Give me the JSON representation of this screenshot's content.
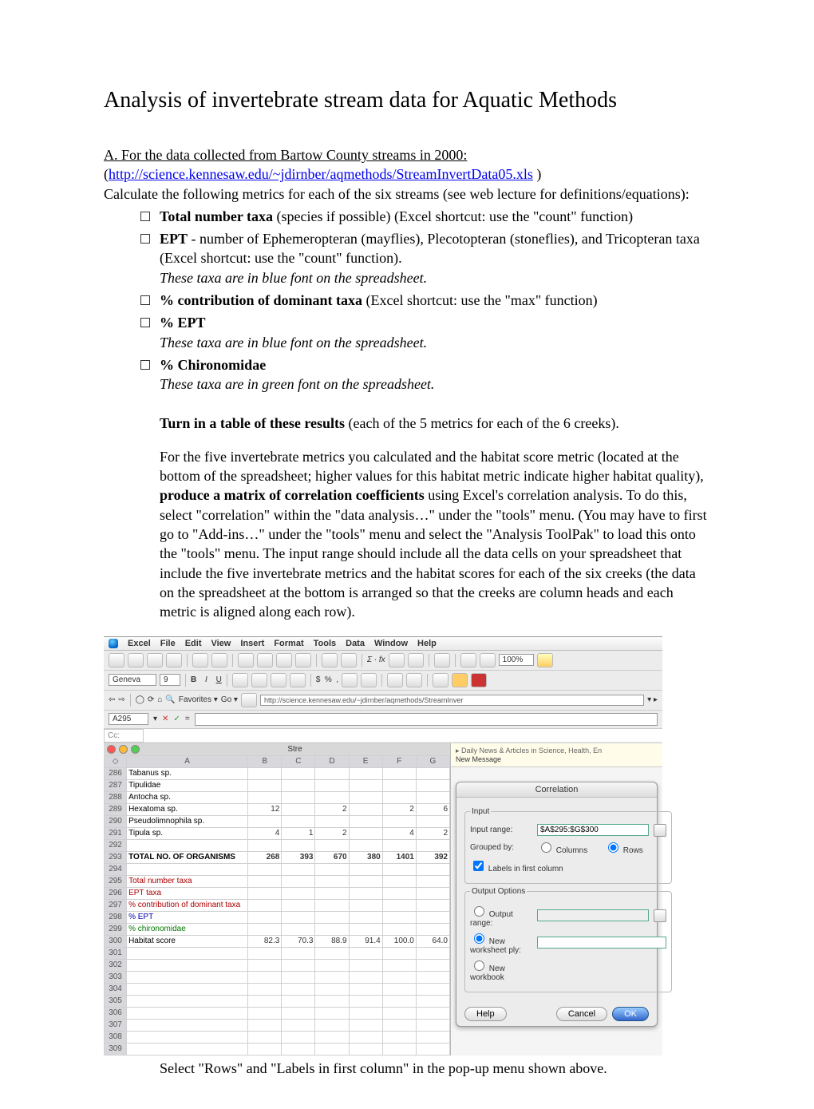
{
  "title": "Analysis of invertebrate stream data for Aquatic Methods",
  "sectionA_intro": "A. For the data collected from Bartow County streams in 2000:",
  "url_text": "http://science.kennesaw.edu/~jdirnber/aqmethods/StreamInvertData05.xls",
  "lead_in": "Calculate the following metrics for each of the six streams (see web lecture for definitions/equations):",
  "bullets": {
    "b1a": "Total number taxa",
    "b1b": " (species if possible)  (Excel shortcut: use the \"count\" function)",
    "b2a": "EPT",
    "b2b": " - number of Ephemeropteran (mayflies), Plecotopteran (stoneflies), and Tricopteran taxa (Excel shortcut: use the \"count\" function).",
    "b2c": "These taxa are in blue font on the spreadsheet.",
    "b3a": "% contribution of dominant taxa",
    "b3b": " (Excel shortcut: use the \"max\" function)",
    "b4a": "% EPT",
    "b4b": "These taxa are in blue font on the spreadsheet.",
    "b5a": "% Chironomidae",
    "b5b": "These taxa are in green font on the spreadsheet."
  },
  "turnin_a": "Turn in a table of these results",
  "turnin_b": " (each of the 5 metrics for each of the 6 creeks).",
  "para2a": "For the five invertebrate metrics you calculated and the habitat score metric (located at the bottom of the spreadsheet; higher values for this habitat metric indicate higher habitat quality), ",
  "para2b": "produce a matrix of correlation coefficients",
  "para2c": " using Excel's correlation analysis.  To do this, select \"correlation\" within the \"data analysis…\" under the \"tools\" menu.  (You may have to first go to \"Add-ins…\" under the \"tools\" menu and select the \"Analysis ToolPak\" to load this onto the \"tools\" menu.  The input range should include all the data cells on your spreadsheet that include the five invertebrate metrics and the habitat scores for each of the six creeks (the data on the spreadsheet at the bottom is arranged so that the creeks are column heads and each metric is aligned along each row).",
  "shot": {
    "menus": [
      "Excel",
      "File",
      "Edit",
      "View",
      "Insert",
      "Format",
      "Tools",
      "Data",
      "Window",
      "Help"
    ],
    "font": "Geneva",
    "size": "9",
    "zoom": "100%",
    "url": "http://science.kennesaw.edu/~jdirnber/aqmethods/StreamInver",
    "cellref": "A295",
    "cc": "Cc:",
    "wintitle": "Stre",
    "newmsg_line1": "Daily News & Articles in Science, Health, En",
    "newmsg_line2": "New Message",
    "cols": [
      "A",
      "B",
      "C",
      "D",
      "E",
      "F",
      "G"
    ],
    "rows": [
      {
        "n": "286",
        "a": "Tabanus sp."
      },
      {
        "n": "287",
        "a": "Tipulidae"
      },
      {
        "n": "288",
        "a": "Antocha sp."
      },
      {
        "n": "289",
        "a": "Hexatoma sp.",
        "b": "12",
        "d": "2",
        "f": "2",
        "g": "6"
      },
      {
        "n": "290",
        "a": "Pseudolimnophila sp."
      },
      {
        "n": "291",
        "a": "Tipula sp.",
        "b": "4",
        "c": "1",
        "d": "2",
        "f": "4",
        "g": "2"
      },
      {
        "n": "292",
        "a": ""
      },
      {
        "n": "293",
        "a": "TOTAL NO. OF ORGANISMS",
        "b": "268",
        "c": "393",
        "d": "670",
        "e": "380",
        "f": "1401",
        "g": "392",
        "bold": true
      },
      {
        "n": "294",
        "a": "",
        "dash": true
      },
      {
        "n": "295",
        "a": "Total number taxa",
        "cls": "red"
      },
      {
        "n": "296",
        "a": "EPT taxa",
        "cls": "red"
      },
      {
        "n": "297",
        "a": "% contribution of dominant taxa",
        "cls": "red"
      },
      {
        "n": "298",
        "a": "% EPT",
        "cls": "blue"
      },
      {
        "n": "299",
        "a": "% chironomidae",
        "cls": "green"
      },
      {
        "n": "300",
        "a": "Habitat score",
        "b": "82.3",
        "c": "70.3",
        "d": "88.9",
        "e": "91.4",
        "f": "100.0",
        "g": "64.0",
        "dash": true
      },
      {
        "n": "301"
      },
      {
        "n": "302"
      },
      {
        "n": "303"
      },
      {
        "n": "304"
      },
      {
        "n": "305"
      },
      {
        "n": "306"
      },
      {
        "n": "307"
      },
      {
        "n": "308"
      },
      {
        "n": "309"
      }
    ],
    "dialog": {
      "title": "Correlation",
      "section1": "Input",
      "input_range_label": "Input range:",
      "input_range_value": "$A$295:$G$300",
      "grouped_label": "Grouped by:",
      "opt_cols": "Columns",
      "opt_rows": "Rows",
      "labels_first": "Labels in first column",
      "section2": "Output Options",
      "out_range": "Output range:",
      "out_ws": "New worksheet ply:",
      "out_wb": "New workbook",
      "help": "Help",
      "cancel": "Cancel",
      "ok": "OK"
    }
  },
  "caption": "Select \"Rows\" and \"Labels in first column\" in the pop-up menu shown above."
}
